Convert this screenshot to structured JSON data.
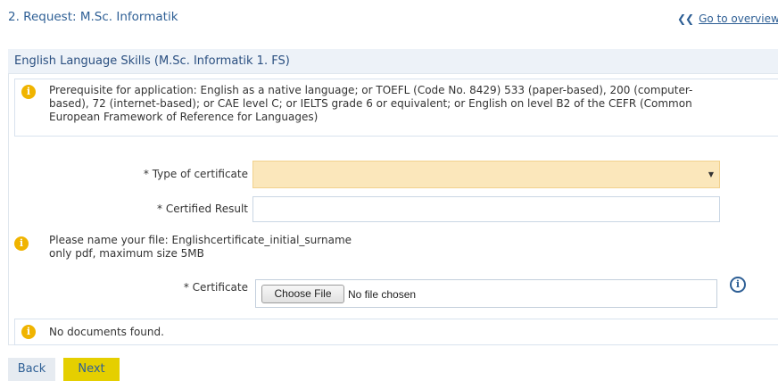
{
  "header": {
    "request_title": "2. Request: M.Sc. Informatik",
    "overview_link": "Go to overview"
  },
  "panel": {
    "title": "English Language Skills (M.Sc. Informatik 1. FS)",
    "prerequisite_lines": [
      "Prerequisite for application: English as a native language; or TOEFL (Code No. 8429) 533 (paper-based), 200 (computer-",
      "based), 72 (internet-based); or CAE level C; or IELTS grade 6 or equivalent; or English on level B2 of the CEFR (Common",
      "European Framework of Reference for Languages)"
    ]
  },
  "form": {
    "type_label": "* Type of certificate",
    "type_value": "",
    "result_label": "* Certified Result",
    "result_value": "",
    "file_note_lines": [
      "Please name your file: Englishcertificate_initial_surname",
      "only pdf, maximum size 5MB"
    ],
    "certificate_label": "* Certificate",
    "choose_file_label": "Choose File",
    "no_file_text": "No file chosen",
    "no_documents_text": "No documents found."
  },
  "buttons": {
    "back_label": "Back",
    "next_label": "Next"
  },
  "colors": {
    "link_blue": "#2e5f95",
    "warning_icon": "#f0b400",
    "select_highlight": "#fbe7bb",
    "next_button": "#e5cf00",
    "back_button": "#e6ebf1"
  },
  "icons": {
    "overview": "double-chevron-left-icon",
    "warning": "info-warning-icon",
    "help": "info-circle-icon",
    "dropdown": "caret-down-icon"
  }
}
